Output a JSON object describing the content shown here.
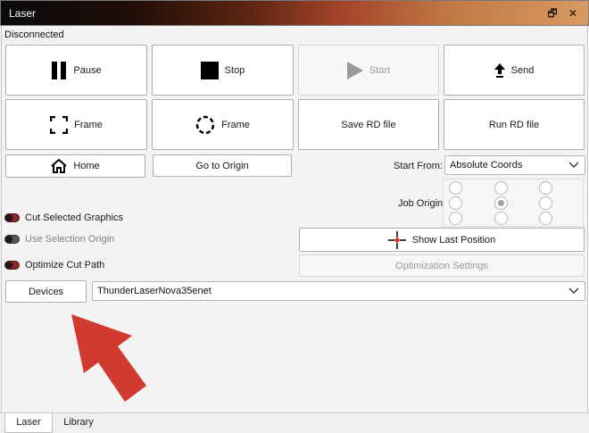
{
  "window": {
    "title": "Laser",
    "restore_glyph": "🗗",
    "close_glyph": "✕"
  },
  "status": "Disconnected",
  "buttons": {
    "pause": "Pause",
    "stop": "Stop",
    "start": "Start",
    "send": "Send",
    "frame_rect": "Frame",
    "frame_circle": "Frame",
    "save_rd": "Save RD file",
    "run_rd": "Run RD file",
    "home": "Home",
    "go_to_origin": "Go to Origin",
    "show_last_position": "Show Last Position",
    "optimization_settings": "Optimization Settings",
    "devices": "Devices"
  },
  "start_from": {
    "label": "Start From:",
    "value": "Absolute Coords"
  },
  "job_origin": {
    "label": "Job Origin",
    "selected": "center"
  },
  "toggles": {
    "cut_selected": {
      "label": "Cut Selected Graphics",
      "on": true
    },
    "use_selection_origin": {
      "label": "Use Selection Origin",
      "on": false
    },
    "optimize_cut_path": {
      "label": "Optimize Cut Path",
      "on": true
    }
  },
  "device_select": {
    "value": "ThunderLaserNova35enet"
  },
  "tabs": [
    {
      "label": "Laser",
      "active": true
    },
    {
      "label": "Library",
      "active": false
    }
  ],
  "colors": {
    "arrow": "#d13b2f",
    "toggle_on": "#8b2424",
    "crosshair": "#e02020"
  },
  "icons": {
    "pause": "pause-icon",
    "stop": "stop-icon",
    "start": "play-icon",
    "send": "upload-arrow-icon",
    "frame_rect": "frame-rectangle-icon",
    "frame_circle": "frame-circle-icon",
    "home": "home-icon",
    "show_last_position": "crosshair-icon"
  }
}
